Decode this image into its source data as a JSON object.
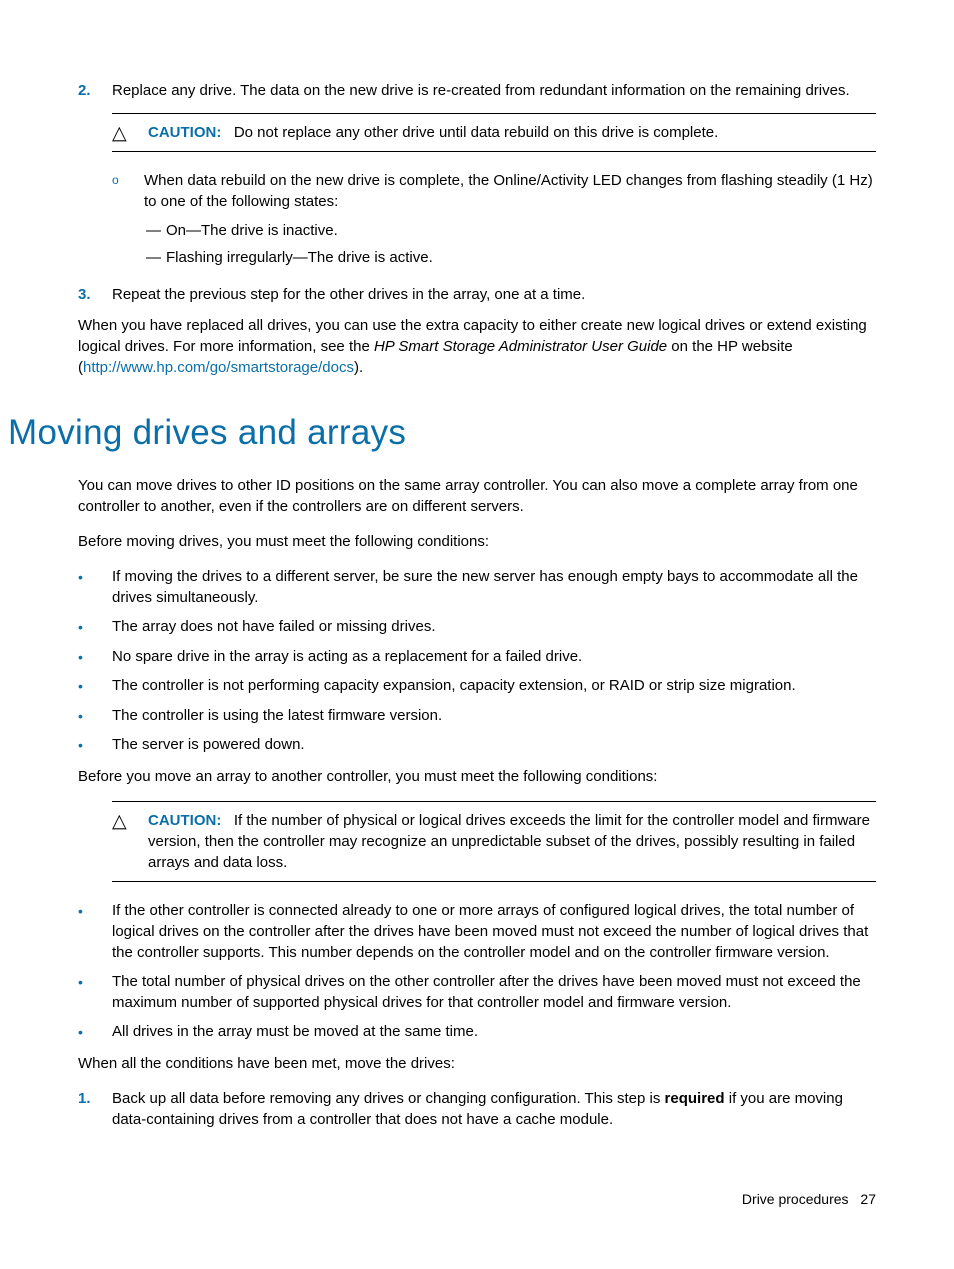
{
  "steps": {
    "s2_num": "2.",
    "s2_text": "Replace any drive. The data on the new drive is re-created from redundant information on the remaining drives.",
    "s3_num": "3.",
    "s3_text": "Repeat the previous step for the other drives in the array, one at a time."
  },
  "caution1": {
    "label": "CAUTION:",
    "text": "Do not replace any other drive until data rebuild on this drive is complete."
  },
  "sub": {
    "circle1": "When data rebuild on the new drive is complete, the Online/Activity LED changes from flashing steadily (1 Hz) to one of the following states:",
    "dash1": "On—The drive is inactive.",
    "dash2": "Flashing irregularly—The drive is active.",
    "dash_marker": "—"
  },
  "para1_pre": "When you have replaced all drives, you can use the extra capacity to either create new logical drives or extend existing logical drives. For more information, see the ",
  "para1_italic": "HP Smart Storage Administrator User Guide",
  "para1_mid": " on the HP website (",
  "para1_link": "http://www.hp.com/go/smartstorage/docs",
  "para1_end": ").",
  "heading": "Moving drives and arrays",
  "para2": "You can move drives to other ID positions on the same array controller. You can also move a complete array from one controller to another, even if the controllers are on different servers.",
  "para3": "Before moving drives, you must meet the following conditions:",
  "bulletsA": {
    "b1": "If moving the drives to a different server, be sure the new server has enough empty bays to accommodate all the drives simultaneously.",
    "b2": "The array does not have failed or missing drives.",
    "b3": "No spare drive in the array is acting as a replacement for a failed drive.",
    "b4": "The controller is not performing capacity expansion, capacity extension, or RAID or strip size migration.",
    "b5": "The controller is using the latest firmware version.",
    "b6": "The server is powered down."
  },
  "para4": "Before you move an array to another controller, you must meet the following conditions:",
  "caution2": {
    "label": "CAUTION:",
    "text": "If the number of physical or logical drives exceeds the limit for the controller model and firmware version, then the controller may recognize an unpredictable subset of the drives, possibly resulting in failed arrays and data loss."
  },
  "bulletsB": {
    "b1": "If the other controller is connected already to one or more arrays of configured logical drives, the total number of logical drives on the controller after the drives have been moved must not exceed the number of logical drives that the controller supports. This number depends on the controller model and on the controller firmware version.",
    "b2": "The total number of physical drives on the other controller after the drives have been moved must not exceed the maximum number of supported physical drives for that controller model and firmware version.",
    "b3": "All drives in the array must be moved at the same time."
  },
  "para5": "When all the conditions have been met, move the drives:",
  "steps2": {
    "s1_num": "1.",
    "s1_pre": "Back up all data before removing any drives or changing configuration. This step is ",
    "s1_bold": "required",
    "s1_post": " if you are moving data-containing drives from a controller that does not have a cache module."
  },
  "footer": {
    "label": "Drive procedures",
    "page": "27"
  },
  "markers": {
    "bullet": "•",
    "circle": "o",
    "triangle": "△"
  }
}
